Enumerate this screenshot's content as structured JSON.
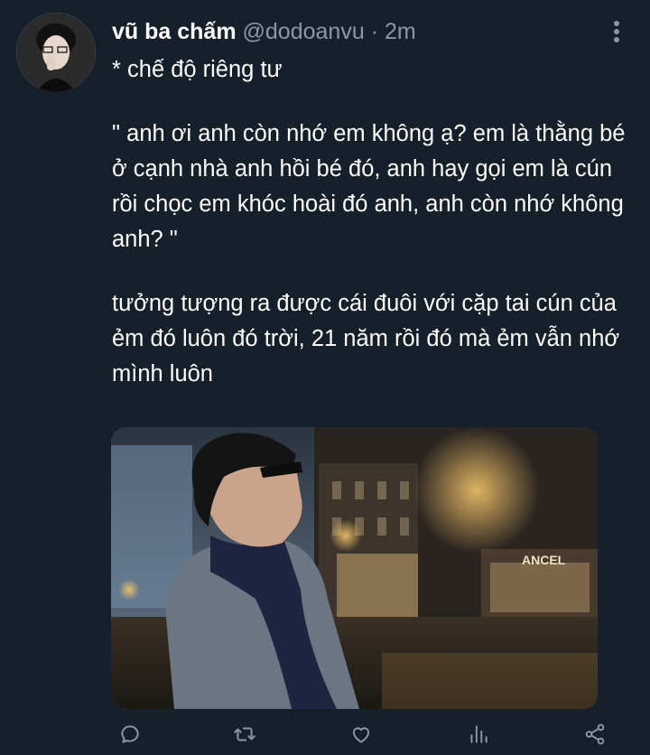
{
  "tweet": {
    "author_name": "vũ ba chấm",
    "handle": "@dodoanvu",
    "separator": "·",
    "time": "2m",
    "subtitle": "* chế độ riêng tư",
    "paragraphs": [
      "\" anh ơi anh còn nhớ em không ạ? em là thằng bé ở cạnh nhà anh hồi bé đó, anh hay gọi em là cún rồi chọc em khóc hoài đó anh, anh còn nhớ không anh? \"",
      "tưởng tượng ra được cái đuôi với cặp tai cún của ẻm đó luôn đó trời, 21 năm rồi đó mà ẻm vẫn nhớ mình luôn"
    ],
    "photo_sign_text": "ANCEL"
  },
  "actions": [
    {
      "name": "reply",
      "icon": "reply-icon"
    },
    {
      "name": "retweet",
      "icon": "retweet-icon"
    },
    {
      "name": "like",
      "icon": "heart-icon"
    },
    {
      "name": "analytics",
      "icon": "analytics-icon"
    },
    {
      "name": "share",
      "icon": "share-icon"
    }
  ],
  "colors": {
    "background": "#15202b",
    "text_primary": "#ffffff",
    "text_secondary": "#8899a6"
  }
}
